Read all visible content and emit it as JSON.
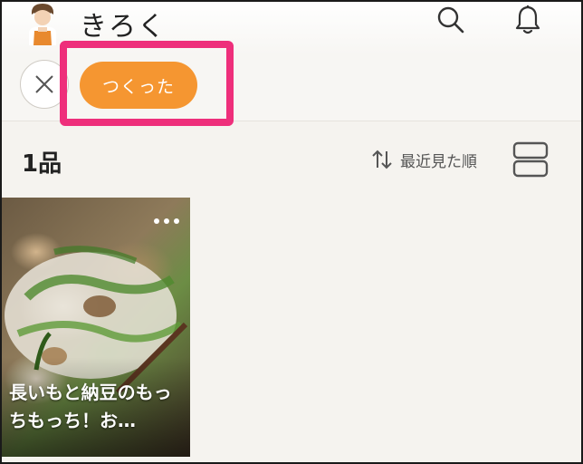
{
  "header": {
    "title": "きろく",
    "icons": {
      "search": "search-icon",
      "notifications": "bell-icon",
      "avatar": "chef-avatar"
    }
  },
  "filter": {
    "clear_icon": "close-icon",
    "active_chip": "つくった",
    "chip_color": "#f59631",
    "highlight_color": "#ee2f7b"
  },
  "summary": {
    "count": "1品",
    "sort_label": "最近見た順",
    "sort_icon": "sort-arrows-icon",
    "layout_icon": "list-view-icon"
  },
  "recipes": [
    {
      "title": "長いもと納豆のもっちもっち！お…",
      "more_icon": "more-dots-icon"
    }
  ]
}
